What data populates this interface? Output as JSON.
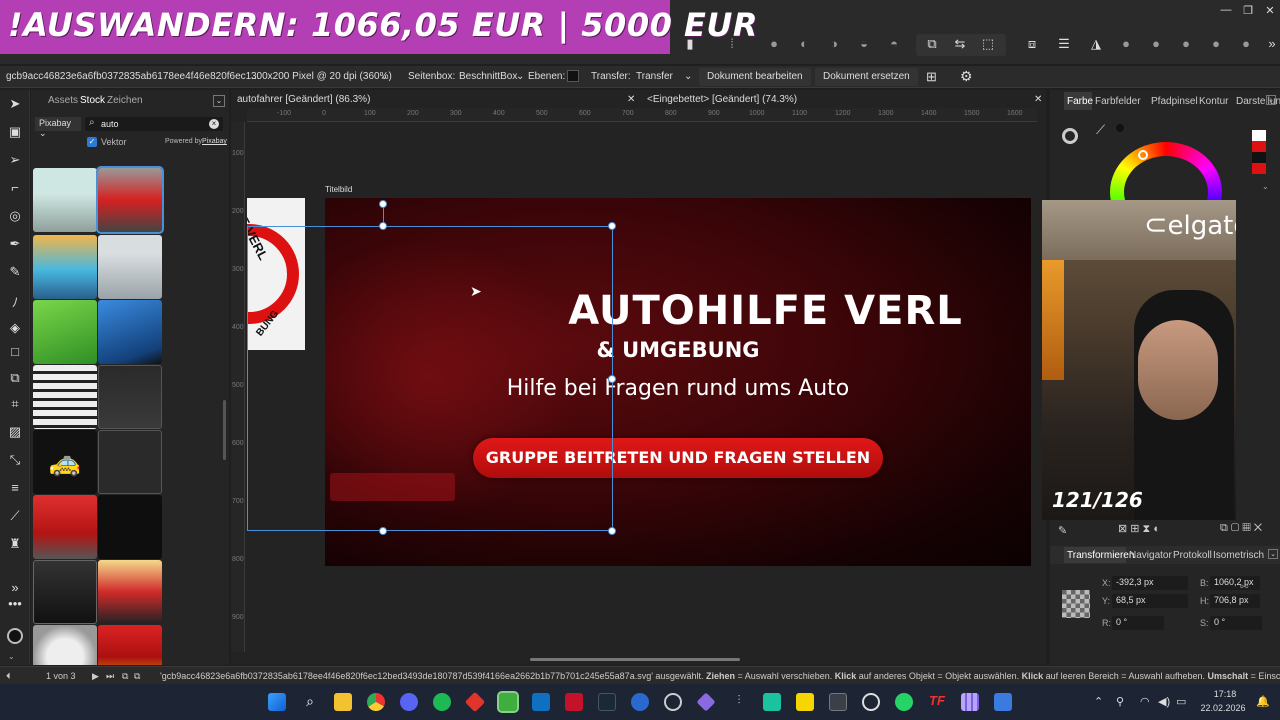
{
  "banner": {
    "text": "!AUSWANDERN: 1066,05 EUR | 5000 EUR"
  },
  "context_bar": {
    "file_id": "gcb9acc46823e6a6fb0372835ab6178ee4f46e820f6ec1...",
    "size_info": "300x200 Pixel @ 20 dpi (360%)",
    "page_box_label": "Seitenbox:",
    "page_box_value": "BeschnittBox",
    "layers_label": "Ebenen:",
    "transfer_label": "Transfer:",
    "transfer_value": "Transfer",
    "edit_doc_button": "Dokument bearbeiten",
    "replace_doc_button": "Dokument ersetzen"
  },
  "assets_panel": {
    "tabs": [
      "Assets",
      "Stock",
      "Zeichen"
    ],
    "source": "Pixabay",
    "search_value": "auto",
    "vector_label": "Vektor",
    "powered_by": "Powered by",
    "powered_by_link": "Pixabay"
  },
  "documents": {
    "tab1": "autofahrer [Geändert] (86.3%)",
    "tab2": "<Eingebettet> [Geändert] (74.3%)"
  },
  "ruler": {
    "h_labels": [
      "-100",
      "0",
      "100",
      "200",
      "300",
      "400",
      "500",
      "600",
      "700",
      "800",
      "900",
      "1000",
      "1100",
      "1200",
      "1300",
      "1400",
      "1500",
      "1600"
    ],
    "v_labels": [
      "100",
      "200",
      "300",
      "400",
      "500",
      "600",
      "700",
      "800",
      "900"
    ]
  },
  "artboard": {
    "label": "Titelbild",
    "headline": "AUTOHILFE VERL",
    "subhead": "& UMGEBUNG",
    "tagline": "Hilfe bei Fragen rund ums Auto",
    "cta": "GRUPPE BEITRETEN UND FRAGEN STELLEN",
    "logo_text_top": "E VERL",
    "logo_text_bottom": "BUNG"
  },
  "right_panel": {
    "tabs": [
      "Farbe",
      "Farbfelder",
      "Pfadpinsel",
      "Kontur",
      "Darstellung"
    ],
    "bottom_tabs": [
      "Transformieren",
      "Navigator",
      "Protokoll",
      "Isometrisch"
    ],
    "transform": {
      "x_label": "X:",
      "x_value": "-392,3 px",
      "y_label": "Y:",
      "y_value": "68,5 px",
      "b_label": "B:",
      "b_value": "1060,2 px",
      "h_label": "H:",
      "h_value": "706,8 px",
      "r_label": "R:",
      "r_value": "0 °",
      "s_label": "S:",
      "s_value": "0 °"
    }
  },
  "webcam": {
    "brand": "elgato",
    "counter": "121/126"
  },
  "status_bar": {
    "page": "1 von 3",
    "message_parts": [
      "'gcb9acc46823e6a6fb0372835ab6178ee4f46e820f6ec12bed3493de180787d539f4166ea2662b1b77b701c245e55a87a.svg' ausgewählt. ",
      "Ziehen",
      " = Auswahl verschieben. ",
      "Klick",
      " auf anderes Objekt = Objekt auswählen. ",
      "Klick",
      " auf leeren Bereich = Auswahl aufheben. ",
      "Umschalt",
      " = Einschränk"
    ]
  },
  "taskbar": {
    "time": "17:18",
    "date": "22.02.2026"
  },
  "colors": {
    "banner": "#b43fb4",
    "cta_red": "#d01010",
    "selection": "#4a90d9",
    "taskbar": "#1d2433"
  }
}
